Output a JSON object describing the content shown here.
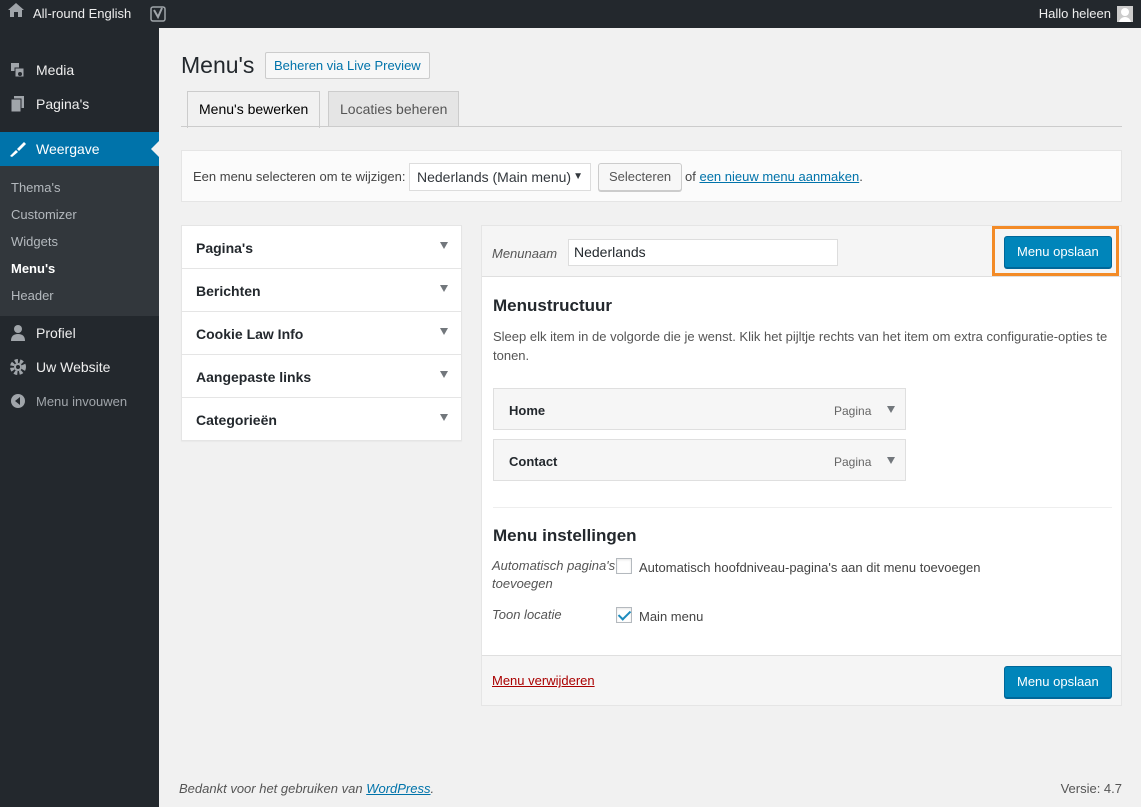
{
  "adminbar": {
    "site_name": "All-round English",
    "howdy": "Hallo heleen"
  },
  "sidebar": {
    "items": [
      {
        "label": "Media",
        "icon": "media-icon"
      },
      {
        "label": "Pagina's",
        "icon": "pages-icon"
      },
      {
        "label": "Weergave",
        "icon": "appearance-icon"
      },
      {
        "label": "Profiel",
        "icon": "user-icon"
      },
      {
        "label": "Uw Website",
        "icon": "tools-icon"
      }
    ],
    "submenu": [
      "Thema's",
      "Customizer",
      "Widgets",
      "Menu's",
      "Header"
    ],
    "collapse": "Menu invouwen"
  },
  "page": {
    "title": "Menu's",
    "live_preview": "Beheren via Live Preview",
    "tabs": [
      "Menu's bewerken",
      "Locaties beheren"
    ]
  },
  "manage": {
    "label": "Een menu selecteren om te wijzigen:",
    "selected": "Nederlands (Main menu)",
    "select_button": "Selecteren",
    "or_text": "of",
    "new_link": "een nieuw menu aanmaken",
    "period": "."
  },
  "accordion": [
    "Pagina's",
    "Berichten",
    "Cookie Law Info",
    "Aangepaste links",
    "Categorieën"
  ],
  "menu_edit": {
    "name_label": "Menunaam",
    "name_value": "Nederlands",
    "save_label": "Menu opslaan",
    "structure_title": "Menustructuur",
    "structure_desc": "Sleep elk item in de volgorde die je wenst. Klik het pijltje rechts van het item om extra configuratie-opties te tonen.",
    "items": [
      {
        "title": "Home",
        "type": "Pagina"
      },
      {
        "title": "Contact",
        "type": "Pagina"
      }
    ],
    "settings_title": "Menu instellingen",
    "auto_add_label": "Automatisch pagina's toevoegen",
    "auto_add_option": "Automatisch hoofdniveau-pagina's aan dit menu toevoegen",
    "auto_add_checked": false,
    "location_label": "Toon locatie",
    "location_option": "Main menu",
    "location_checked": true,
    "delete_label": "Menu verwijderen"
  },
  "footer": {
    "thanks": "Bedankt voor het gebruiken van",
    "wp_link": "WordPress",
    "period": ".",
    "version": "Versie: 4.7"
  },
  "colors": {
    "accent": "#0073aa",
    "primary_button": "#0085ba",
    "highlight": "#f38b27",
    "sidebar": "#23282d"
  }
}
